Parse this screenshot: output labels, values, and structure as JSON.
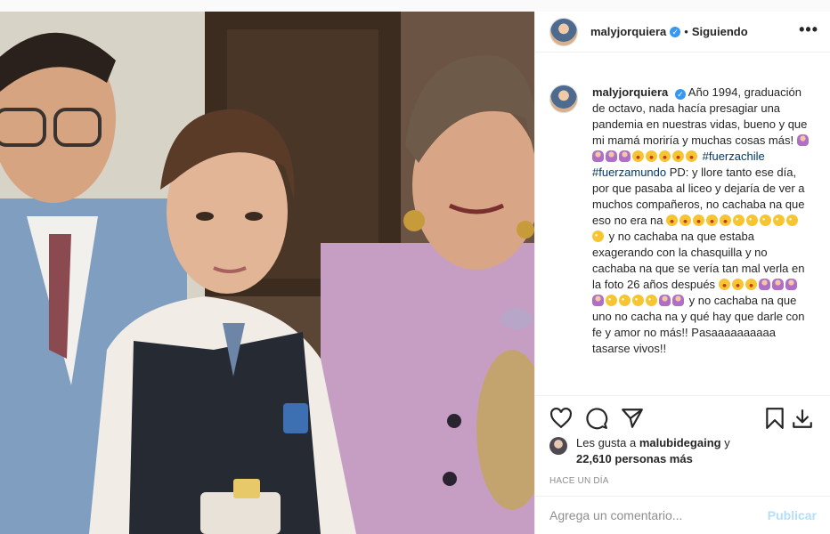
{
  "post": {
    "username": "malyjorquiera",
    "verified_icon": "verified-badge-icon",
    "separator": "•",
    "follow_label": "Siguiendo",
    "more_label": "•••",
    "caption": {
      "username": "malyjorquiera",
      "line_1": "Año 1994, graduación de octavo, nada hacía presagiar una pandemia en nuestras vidas, bueno y que mi mamá moriría y muchas cosas más!",
      "hashtag_1": "#fuerzachile",
      "hashtag_2": "#fuerzamundo",
      "line_2": "PD: y llore tanto ese día, por que pasaba al liceo y dejaría de ver a muchos compañeros, no cachaba na que eso no era na",
      "line_3": "y no cachaba na que estaba exagerando con la chasquilla y no cachaba na que se vería tan mal verla en la foto 26 años después",
      "line_4": "y no cachaba na que uno no cacha na y qué hay que darle con fe y amor no más!!",
      "line_5": "Pasaaaaaaaaaa tasarse vivos!!"
    },
    "likes": {
      "prefix": "Les gusta a",
      "liker": "malubidegaing",
      "conj": "y",
      "others": "22,610 personas más"
    },
    "time": "Hace un día",
    "comment_placeholder": "Agrega un comentario...",
    "publish_label": "Publicar"
  },
  "colors": {
    "link_blue": "#00376b",
    "verified_blue": "#3897f0",
    "publish_disabled": "#b2dffc",
    "muted_gray": "#8e8e8e"
  }
}
